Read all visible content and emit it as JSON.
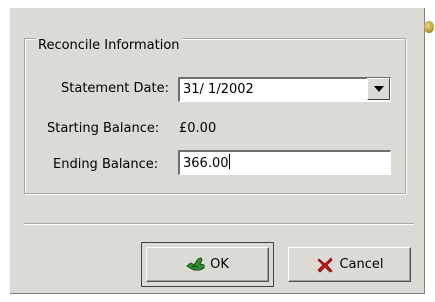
{
  "reconcile": {
    "group_title": "Reconcile Information",
    "statement_date_label": "Statement Date:",
    "statement_date_value": "31/ 1/2002",
    "starting_balance_label": "Starting Balance:",
    "starting_balance_value": "£0.00",
    "ending_balance_label": "Ending Balance:",
    "ending_balance_value": "366.00"
  },
  "buttons": {
    "ok_label": "OK",
    "cancel_label": "Cancel"
  },
  "icons": {
    "ok": "ok-hand-icon",
    "cancel": "cancel-x-icon",
    "dropdown": "triangle-down-icon",
    "corner": "corner-knob-icon"
  },
  "colors": {
    "dialog_bg": "#dcdad5",
    "input_bg": "#ffffff",
    "ok_icon": "#1f7a1f",
    "cancel_icon": "#c81818"
  }
}
